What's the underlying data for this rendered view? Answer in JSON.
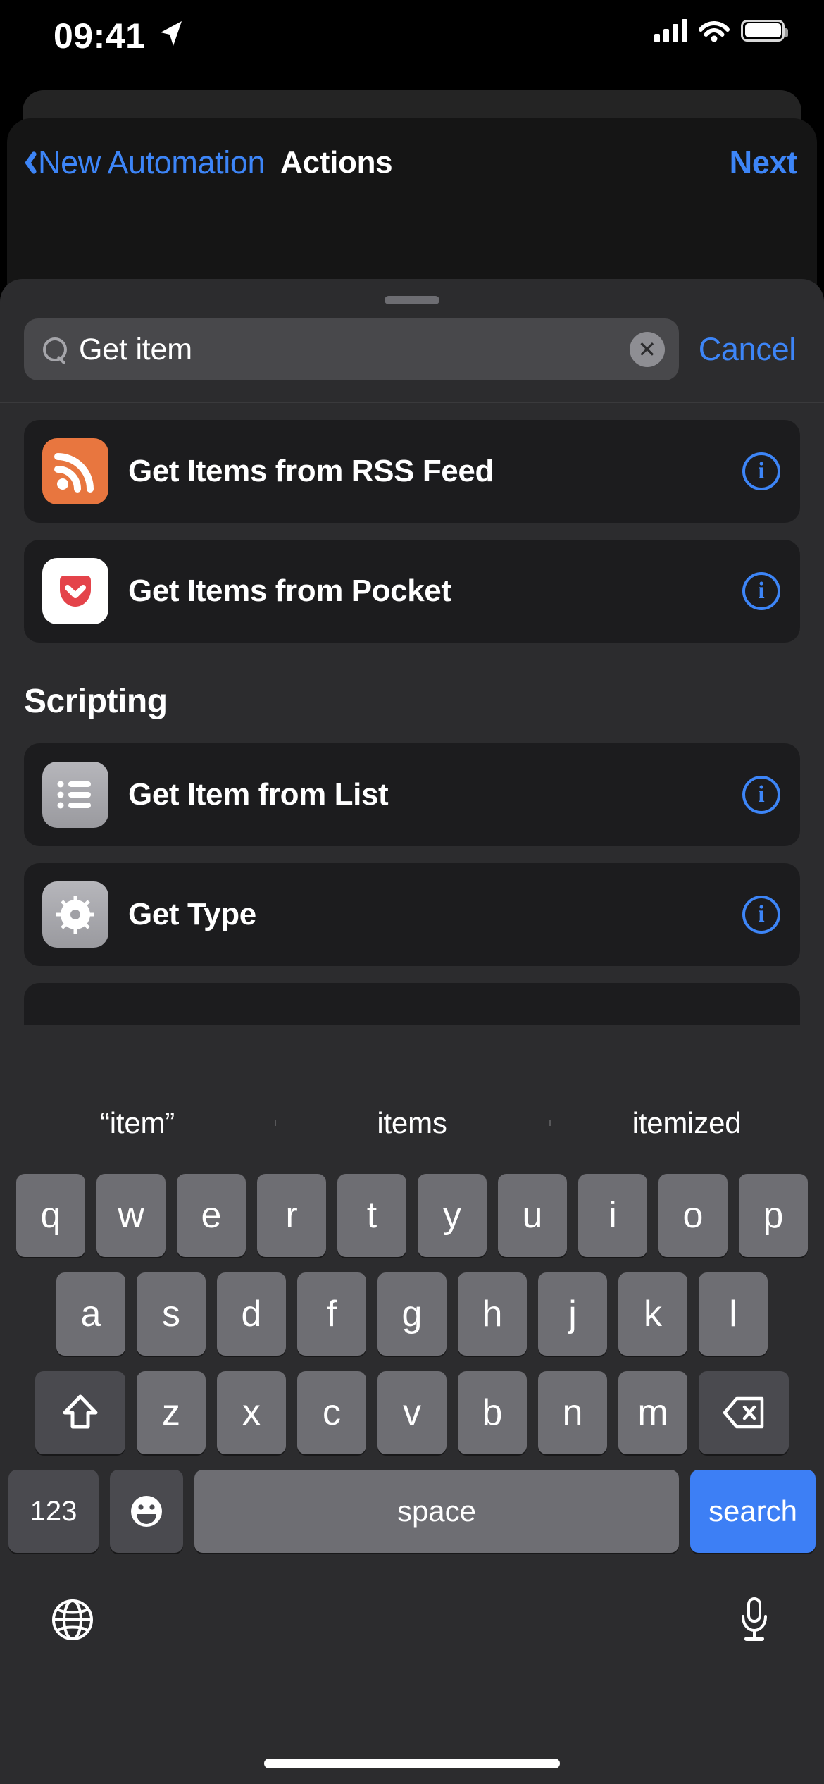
{
  "status_bar": {
    "time": "09:41",
    "location_icon": "location-arrow-icon",
    "signal_icon": "cellular-signal-icon",
    "wifi_icon": "wifi-icon",
    "battery_icon": "battery-icon"
  },
  "nav_bar": {
    "back_label": "New Automation",
    "back_icon": "chevron-left-icon",
    "title": "Actions",
    "next_label": "Next"
  },
  "sheet": {
    "grabber": "drag-handle",
    "search": {
      "value": "Get item",
      "placeholder": "Search",
      "search_icon": "search-icon",
      "clear_icon": "clear-circle-icon",
      "clear_glyph": "✕",
      "cancel_label": "Cancel"
    },
    "sections": [
      {
        "header": "",
        "rows": [
          {
            "label": "Get Items from RSS Feed",
            "icon": "rss-icon",
            "icon_bg": "#e8763f",
            "info": "info-icon"
          },
          {
            "label": "Get Items from Pocket",
            "icon": "pocket-icon",
            "icon_bg": "#ffffff",
            "info": "info-icon"
          }
        ]
      },
      {
        "header": "Scripting",
        "rows": [
          {
            "label": "Get Item from List",
            "icon": "list-icon",
            "icon_bg": "#a8a8ad",
            "info": "info-icon"
          },
          {
            "label": "Get Type",
            "icon": "gear-icon",
            "icon_bg": "#a8a8ad",
            "info": "info-icon"
          }
        ]
      }
    ]
  },
  "keyboard": {
    "predictions": [
      "“item”",
      "items",
      "itemized"
    ],
    "row1": [
      "q",
      "w",
      "e",
      "r",
      "t",
      "y",
      "u",
      "i",
      "o",
      "p"
    ],
    "row2": [
      "a",
      "s",
      "d",
      "f",
      "g",
      "h",
      "j",
      "k",
      "l"
    ],
    "row3": [
      "z",
      "x",
      "c",
      "v",
      "b",
      "n",
      "m"
    ],
    "shift_icon": "shift-icon",
    "delete_icon": "backspace-icon",
    "numbers_label": "123",
    "emoji_icon": "emoji-icon",
    "space_label": "space",
    "return_label": "search",
    "globe_icon": "globe-icon",
    "mic_icon": "microphone-icon",
    "return_key_color": "#3d7ff5"
  },
  "home_indicator": "home-indicator"
}
